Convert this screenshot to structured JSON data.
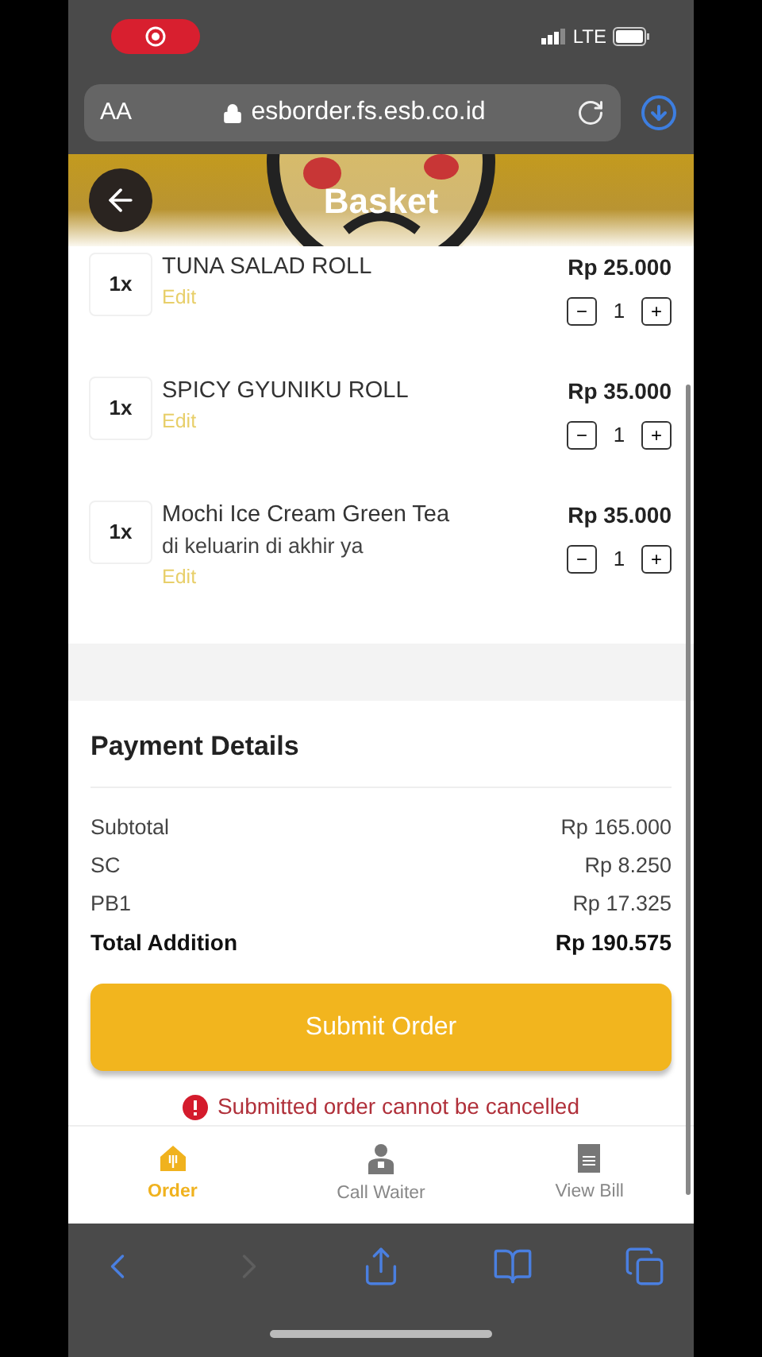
{
  "status_bar": {
    "network": "LTE"
  },
  "browser": {
    "text_size": "AA",
    "url": "esborder.fs.esb.co.id"
  },
  "header": {
    "title": "Basket"
  },
  "items": [
    {
      "count": "1x",
      "name": "TUNA SALAD ROLL",
      "edit": "Edit",
      "price": "Rp 25.000",
      "quantity": "1",
      "minus": "−",
      "plus": "+"
    },
    {
      "count": "1x",
      "name": "SPICY GYUNIKU ROLL",
      "edit": "Edit",
      "price": "Rp 35.000",
      "quantity": "1",
      "minus": "−",
      "plus": "+"
    },
    {
      "count": "1x",
      "name": "Mochi Ice Cream Green Tea",
      "note": "di keluarin di akhir ya",
      "edit": "Edit",
      "price": "Rp 35.000",
      "quantity": "1",
      "minus": "−",
      "plus": "+"
    }
  ],
  "payment": {
    "title": "Payment Details",
    "lines": [
      {
        "label": "Subtotal",
        "value": "Rp 165.000",
        "total": false
      },
      {
        "label": "SC",
        "value": "Rp 8.250",
        "total": false
      },
      {
        "label": "PB1",
        "value": "Rp 17.325",
        "total": false
      },
      {
        "label": "Total Addition",
        "value": "Rp 190.575",
        "total": true
      }
    ],
    "submit": "Submit Order",
    "warning": "Submitted order cannot be cancelled"
  },
  "bottom_nav": [
    {
      "kind": "order",
      "label": "Order",
      "selected": true
    },
    {
      "kind": "waiter",
      "label": "Call Waiter",
      "selected": false
    },
    {
      "kind": "bill",
      "label": "View Bill",
      "selected": false
    }
  ],
  "toolbar": [
    {
      "kind": "back",
      "disabled": false
    },
    {
      "kind": "forward",
      "disabled": true
    },
    {
      "kind": "share",
      "disabled": false
    },
    {
      "kind": "bookmarks",
      "disabled": false
    },
    {
      "kind": "tabs",
      "disabled": false
    }
  ]
}
